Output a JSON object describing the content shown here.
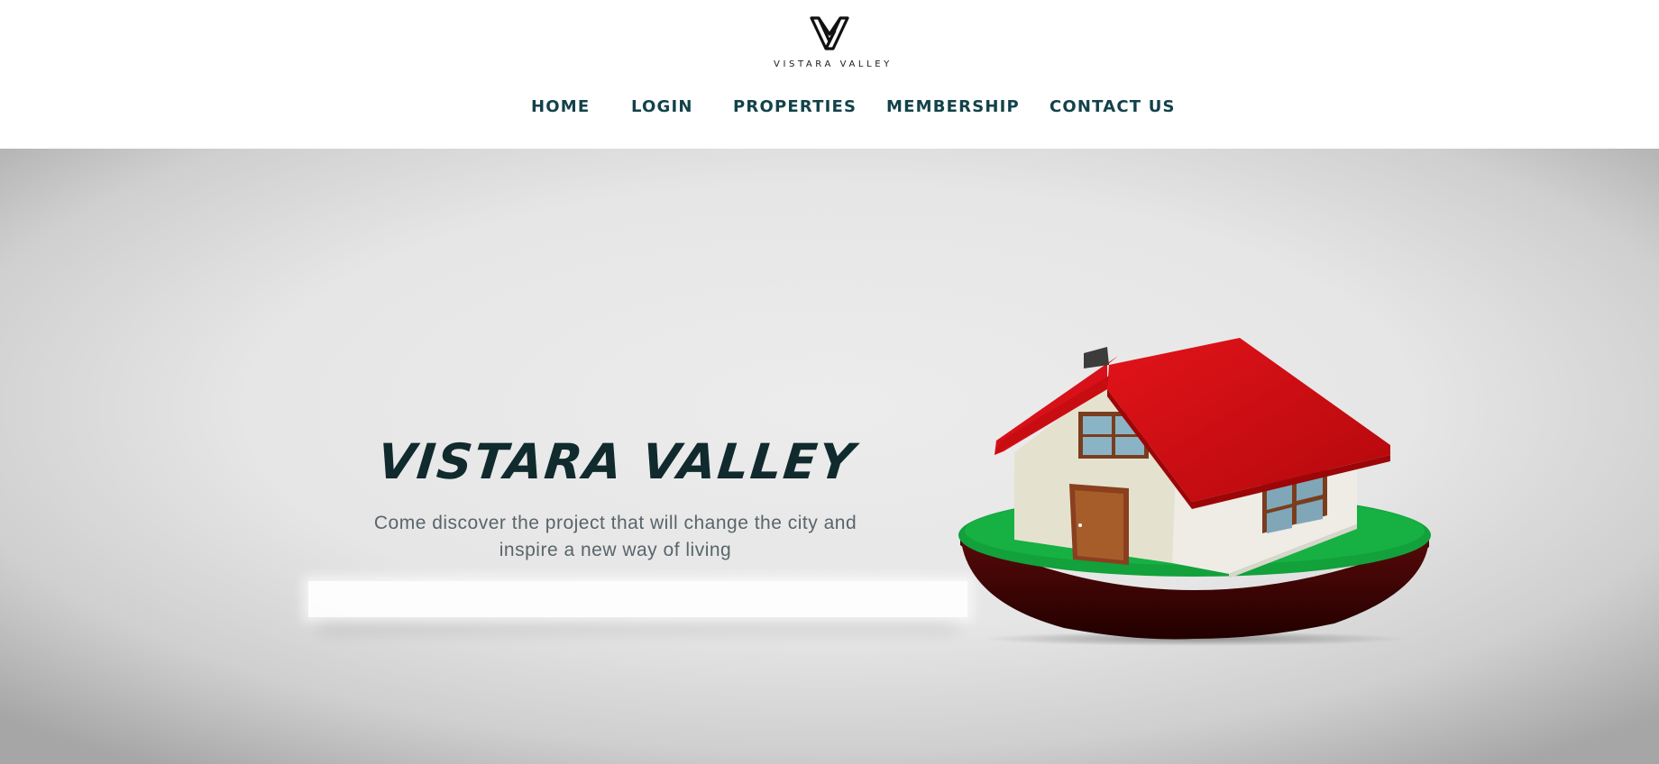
{
  "brand": {
    "logo_text": "VISTARA VALLEY",
    "logo_icon": "v-monogram-icon"
  },
  "nav": {
    "items": [
      {
        "label": "HOME"
      },
      {
        "label": "LOGIN"
      },
      {
        "label": "PROPERTIES"
      },
      {
        "label": "MEMBERSHIP"
      },
      {
        "label": "CONTACT US"
      }
    ]
  },
  "hero": {
    "title": "VISTARA VALLEY",
    "subtitle": "Come discover the project that will change the city and inspire a new way of living",
    "image": "house-illustration"
  },
  "colors": {
    "nav_text": "#12424a",
    "title_text": "#102a2d",
    "subtitle_text": "#59656a",
    "roof": "#d60d12",
    "grass": "#12a13b",
    "door": "#a65d2a"
  }
}
